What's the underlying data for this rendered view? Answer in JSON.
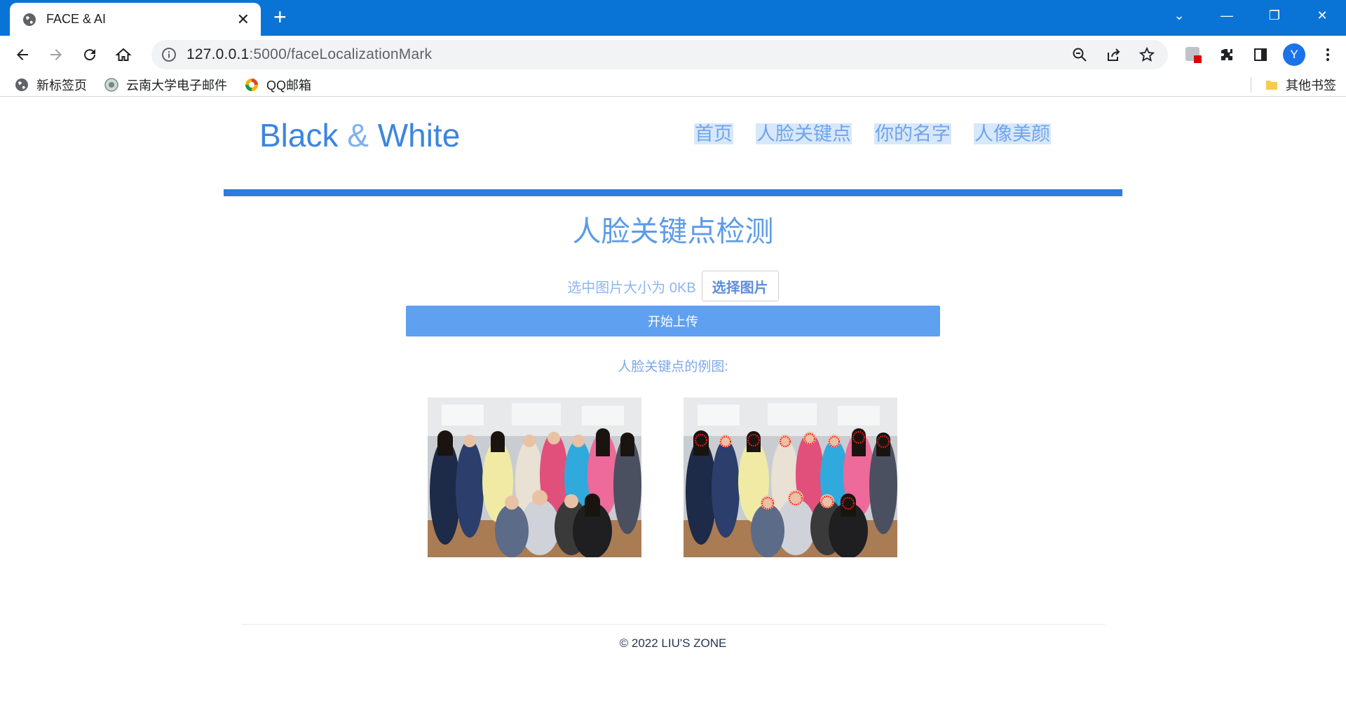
{
  "browser": {
    "tab_title": "FACE & AI",
    "url_host": "127.0.0.1",
    "url_rest": ":5000/faceLocalizationMark",
    "bookmarks": [
      "新标签页",
      "云南大学电子邮件",
      "QQ邮箱"
    ],
    "other_bookmarks": "其他书签",
    "avatar_letter": "Y"
  },
  "site": {
    "brand_first": "Black",
    "brand_amp": "&",
    "brand_second": "White",
    "nav": [
      "首页",
      "人脸关键点",
      "你的名字",
      "人像美颜"
    ],
    "accent_color": "#2f7ce0"
  },
  "main": {
    "heading": "人脸关键点检测",
    "size_text": "选中图片大小为 0KB",
    "pick_button": "选择图片",
    "upload_button": "开始上传",
    "example_label": "人脸关键点的例图:"
  },
  "footer": {
    "text": "© 2022 LIU'S ZONE"
  },
  "icons": [
    "globe-icon",
    "close-icon",
    "plus-icon",
    "back-icon",
    "forward-icon",
    "reload-icon",
    "home-icon",
    "info-icon",
    "zoom-out-icon",
    "share-icon",
    "star-icon",
    "extension-icon",
    "puzzle-icon",
    "sidepanel-icon",
    "menu-icon",
    "folder-icon"
  ]
}
